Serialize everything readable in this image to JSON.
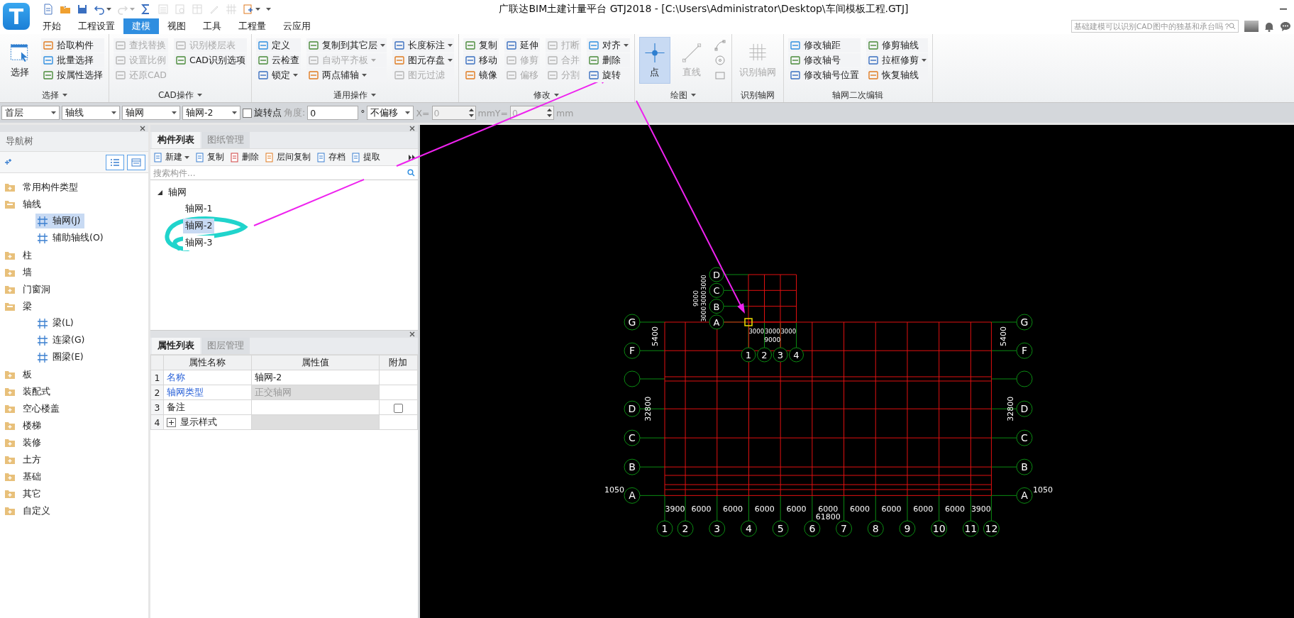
{
  "app": {
    "logo": "T",
    "title": "广联达BIM土建计量平台 GTJ2018 - [C:\\Users\\Administrator\\Desktop\\车间模板工程.GTJ]"
  },
  "quick_access": [
    {
      "kind": "document",
      "disabled": false,
      "has_menu": false
    },
    {
      "kind": "folder",
      "disabled": false,
      "has_menu": false
    },
    {
      "kind": "save",
      "disabled": false,
      "has_menu": false
    },
    {
      "kind": "undo",
      "disabled": false,
      "has_menu": true
    },
    {
      "kind": "redo",
      "disabled": true,
      "has_menu": true
    },
    {
      "kind": "sum",
      "disabled": false,
      "has_menu": false
    },
    {
      "kind": "report",
      "disabled": true,
      "has_menu": false
    },
    {
      "kind": "query",
      "disabled": true,
      "has_menu": false
    },
    {
      "kind": "table",
      "disabled": true,
      "has_menu": false
    },
    {
      "kind": "pencil",
      "disabled": true,
      "has_menu": false
    },
    {
      "kind": "grid",
      "disabled": true,
      "has_menu": false
    },
    {
      "kind": "export",
      "disabled": false,
      "has_menu": true
    },
    {
      "kind": "customize",
      "disabled": false,
      "has_menu": true
    }
  ],
  "tabs": [
    {
      "label": "开始",
      "selected": false
    },
    {
      "label": "工程设置",
      "selected": false
    },
    {
      "label": "建模",
      "selected": true
    },
    {
      "label": "视图",
      "selected": false
    },
    {
      "label": "工具",
      "selected": false
    },
    {
      "label": "工程量",
      "selected": false
    },
    {
      "label": "云应用",
      "selected": false
    }
  ],
  "search": {
    "placeholder": "基础建模可以识别CAD图中的独基和承台吗？"
  },
  "ribbon": [
    {
      "label": "选择",
      "has_menu": true,
      "parts": [
        {
          "kind": "large",
          "label": "选择",
          "selected": false,
          "disabled": false
        },
        {
          "kind": "column",
          "items": [
            {
              "label": "拾取构件",
              "disabled": false,
              "has_menu": false
            },
            {
              "label": "批量选择",
              "disabled": false,
              "has_menu": false
            },
            {
              "label": "按属性选择",
              "disabled": false,
              "has_menu": false
            }
          ]
        }
      ]
    },
    {
      "label": "CAD操作",
      "has_menu": true,
      "parts": [
        {
          "kind": "column",
          "items": [
            {
              "label": "查找替换",
              "disabled": true,
              "has_menu": false
            },
            {
              "label": "设置比例",
              "disabled": true,
              "has_menu": false
            },
            {
              "label": "还原CAD",
              "disabled": true,
              "has_menu": false
            }
          ]
        },
        {
          "kind": "column",
          "items": [
            {
              "label": "识别楼层表",
              "disabled": true,
              "has_menu": false
            },
            {
              "label": "CAD识别选项",
              "disabled": false,
              "has_menu": false
            }
          ]
        }
      ]
    },
    {
      "label": "通用操作",
      "has_menu": true,
      "parts": [
        {
          "kind": "column",
          "items": [
            {
              "label": "定义",
              "disabled": false,
              "has_menu": false
            },
            {
              "label": "云检查",
              "disabled": false,
              "has_menu": false
            },
            {
              "label": "锁定",
              "disabled": false,
              "has_menu": true
            }
          ]
        },
        {
          "kind": "column",
          "items": [
            {
              "label": "复制到其它层",
              "disabled": false,
              "has_menu": true
            },
            {
              "label": "自动平齐板",
              "disabled": true,
              "has_menu": true
            },
            {
              "label": "两点辅轴",
              "disabled": false,
              "has_menu": true
            }
          ]
        },
        {
          "kind": "column",
          "items": [
            {
              "label": "长度标注",
              "disabled": false,
              "has_menu": true
            },
            {
              "label": "图元存盘",
              "disabled": false,
              "has_menu": true
            },
            {
              "label": "图元过滤",
              "disabled": true,
              "has_menu": false
            }
          ]
        }
      ]
    },
    {
      "label": "修改",
      "has_menu": true,
      "parts": [
        {
          "kind": "column",
          "items": [
            {
              "label": "复制",
              "disabled": false,
              "has_menu": false
            },
            {
              "label": "移动",
              "disabled": false,
              "has_menu": false
            },
            {
              "label": "镜像",
              "disabled": false,
              "has_menu": false
            }
          ]
        },
        {
          "kind": "column",
          "items": [
            {
              "label": "延伸",
              "disabled": false,
              "has_menu": false
            },
            {
              "label": "修剪",
              "disabled": true,
              "has_menu": false
            },
            {
              "label": "偏移",
              "disabled": true,
              "has_menu": false
            }
          ]
        },
        {
          "kind": "column",
          "items": [
            {
              "label": "打断",
              "disabled": true,
              "has_menu": false
            },
            {
              "label": "合并",
              "disabled": true,
              "has_menu": false
            },
            {
              "label": "分割",
              "disabled": true,
              "has_menu": false
            }
          ]
        },
        {
          "kind": "column",
          "items": [
            {
              "label": "对齐",
              "disabled": false,
              "has_menu": true
            },
            {
              "label": "删除",
              "disabled": false,
              "has_menu": false
            },
            {
              "label": "旋转",
              "disabled": false,
              "has_menu": false
            }
          ]
        }
      ]
    },
    {
      "label": "绘图",
      "has_menu": true,
      "parts": [
        {
          "kind": "large",
          "label": "点",
          "selected": true,
          "disabled": false
        },
        {
          "kind": "large",
          "label": "直线",
          "selected": false,
          "disabled": true
        },
        {
          "kind": "icons",
          "items": [
            {
              "kind": "arc",
              "disabled": true
            },
            {
              "kind": "circle",
              "disabled": true
            },
            {
              "kind": "rect",
              "disabled": true
            }
          ]
        }
      ]
    },
    {
      "label": "识别轴网",
      "has_menu": false,
      "parts": [
        {
          "kind": "large",
          "label": "识别轴网",
          "selected": false,
          "disabled": true
        }
      ]
    },
    {
      "label": "轴网二次编辑",
      "has_menu": false,
      "parts": [
        {
          "kind": "column",
          "items": [
            {
              "label": "修改轴距",
              "disabled": false,
              "has_menu": false
            },
            {
              "label": "修改轴号",
              "disabled": false,
              "has_menu": false
            },
            {
              "label": "修改轴号位置",
              "disabled": false,
              "has_menu": false
            }
          ]
        },
        {
          "kind": "column",
          "items": [
            {
              "label": "修剪轴线",
              "disabled": false,
              "has_menu": false
            },
            {
              "label": "拉框修剪",
              "disabled": false,
              "has_menu": true
            },
            {
              "label": "恢复轴线",
              "disabled": false,
              "has_menu": false
            }
          ]
        }
      ]
    }
  ],
  "toolbar": {
    "selects": [
      "首层",
      "轴线",
      "轴网",
      "轴网-2"
    ],
    "rotate": {
      "label": "旋转点",
      "checked": false
    },
    "angle_label": "角度:",
    "angle_value": "0",
    "degree": "°",
    "offset": "不偏移",
    "x_label": "X=",
    "x_value": "0",
    "y_label": "mmY=",
    "y_value": "0",
    "unit": "mm",
    "coords_disabled": true
  },
  "nav_panel": {
    "title": "导航树",
    "items": [
      {
        "label": "常用构件类型",
        "expanded": false
      },
      {
        "label": "轴线",
        "expanded": true,
        "children": [
          {
            "label": "轴网(J)",
            "selected": true
          },
          {
            "label": "辅助轴线(O)",
            "selected": false
          }
        ]
      },
      {
        "label": "柱",
        "expanded": false
      },
      {
        "label": "墙",
        "expanded": false
      },
      {
        "label": "门窗洞",
        "expanded": false
      },
      {
        "label": "梁",
        "expanded": true,
        "children": [
          {
            "label": "梁(L)",
            "selected": false
          },
          {
            "label": "连梁(G)",
            "selected": false
          },
          {
            "label": "圈梁(E)",
            "selected": false
          }
        ]
      },
      {
        "label": "板",
        "expanded": false
      },
      {
        "label": "装配式",
        "expanded": false
      },
      {
        "label": "空心楼盖",
        "expanded": false
      },
      {
        "label": "楼梯",
        "expanded": false
      },
      {
        "label": "装修",
        "expanded": false
      },
      {
        "label": "土方",
        "expanded": false
      },
      {
        "label": "基础",
        "expanded": false
      },
      {
        "label": "其它",
        "expanded": false
      },
      {
        "label": "自定义",
        "expanded": false
      }
    ]
  },
  "component_panel": {
    "tabs": [
      {
        "label": "构件列表",
        "selected": true
      },
      {
        "label": "图纸管理",
        "selected": false
      }
    ],
    "tools": [
      {
        "label": "新建",
        "has_menu": true
      },
      {
        "label": "复制",
        "has_menu": false
      },
      {
        "label": "删除",
        "has_menu": false
      },
      {
        "label": "层间复制",
        "has_menu": false
      },
      {
        "label": "存档",
        "has_menu": false
      },
      {
        "label": "提取",
        "has_menu": false
      }
    ],
    "search_placeholder": "搜索构件...",
    "tree": {
      "label": "轴网",
      "expanded": true,
      "children": [
        {
          "label": "轴网-1",
          "selected": false
        },
        {
          "label": "轴网-2",
          "selected": true
        },
        {
          "label": "轴网-3",
          "selected": false
        }
      ]
    }
  },
  "property_panel": {
    "tabs": [
      {
        "label": "属性列表",
        "selected": true
      },
      {
        "label": "图层管理",
        "selected": false
      }
    ],
    "columns": [
      "属性名称",
      "属性值",
      "附加"
    ],
    "rows": [
      {
        "index": "1",
        "name": "名称",
        "public": true,
        "value": "轴网-2",
        "readonly": false,
        "expandable": false
      },
      {
        "index": "2",
        "name": "轴网类型",
        "public": true,
        "value": "正交轴网",
        "readonly": true,
        "expandable": false
      },
      {
        "index": "3",
        "name": "备注",
        "public": false,
        "readonly": false,
        "expandable": false,
        "extra_checked": false
      },
      {
        "index": "4",
        "name": "显示样式",
        "public": false,
        "readonly": true,
        "expandable": true,
        "expanded": false
      }
    ]
  },
  "canvas": {
    "main_grid": {
      "columns": [
        "1",
        "2",
        "3",
        "4",
        "5",
        "6",
        "7",
        "8",
        "9",
        "10",
        "11",
        "12"
      ],
      "column_dims": [
        "3900",
        "6000",
        "6000",
        "6000",
        "6000",
        "6000",
        "6000",
        "6000",
        "6000",
        "6000",
        "3900"
      ],
      "column_total": "61800",
      "rows": [
        "G",
        "F",
        "D",
        "C",
        "B",
        "A"
      ],
      "right_rows": [
        "G",
        "F",
        "D",
        "C",
        "B",
        "A"
      ],
      "left_dims": [
        "5400",
        "32800",
        "1050"
      ],
      "right_dims": [
        "5400",
        "32800",
        "1050"
      ]
    },
    "small_grid": {
      "columns": [
        "1",
        "2",
        "3",
        "4"
      ],
      "column_dims": [
        "3000",
        "3000",
        "3000"
      ],
      "column_total": "9000",
      "rows": [
        "D",
        "C",
        "B",
        "A"
      ],
      "row_dims": [
        "3000",
        "3000",
        "3000"
      ],
      "row_total": "9000"
    }
  }
}
